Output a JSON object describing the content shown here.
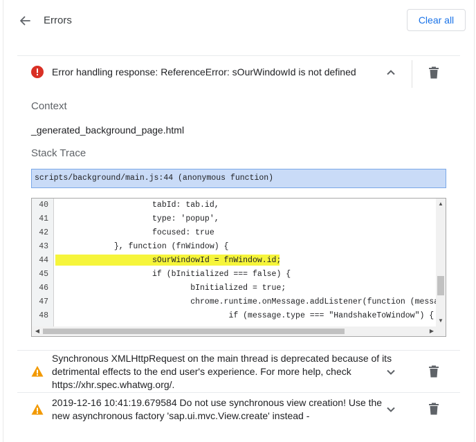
{
  "header": {
    "title": "Errors",
    "clear_label": "Clear all"
  },
  "errors": [
    {
      "level": "error",
      "message": "Error handling response: ReferenceError: sOurWindowId is not defined",
      "expanded": true
    },
    {
      "level": "warning",
      "message_lines": [
        "Synchronous XMLHttpRequest on the main thread is deprecated because of its",
        "detrimental effects to the end user's experience. For more help, check",
        "https://xhr.spec.whatwg.org/."
      ],
      "expanded": false
    },
    {
      "level": "warning",
      "message_lines": [
        "2019-12-16 10:41:19.679584 Do not use synchronous view creation! Use the",
        "new asynchronous factory 'sap.ui.mvc.View.create' instead -"
      ],
      "expanded": false
    }
  ],
  "details": {
    "context_label": "Context",
    "context_value": "_generated_background_page.html",
    "stack_label": "Stack Trace",
    "stack_frame": "scripts/background/main.js:44 (anonymous function)"
  },
  "code": {
    "highlight_line": 44,
    "lines": [
      {
        "n": "40",
        "text": "                    tabId: tab.id,"
      },
      {
        "n": "41",
        "text": "                    type: 'popup',"
      },
      {
        "n": "42",
        "text": "                    focused: true"
      },
      {
        "n": "43",
        "text": "            }, function (fnWindow) {"
      },
      {
        "n": "44",
        "text": "                    sOurWindowId = fnWindow.id;"
      },
      {
        "n": "45",
        "text": "                    if (bInitialized === false) {"
      },
      {
        "n": "46",
        "text": "                            bInitialized = true;"
      },
      {
        "n": "47",
        "text": "                            chrome.runtime.onMessage.addListener(function (message,"
      },
      {
        "n": "48",
        "text": "                                    if (message.type === \"HandshakeToWindow\") {"
      }
    ]
  },
  "colors": {
    "accent": "#1a73e8",
    "error": "#d93025",
    "warning": "#f29900",
    "highlight": "#f6f53b",
    "selected_frame": "#c9dbf7"
  }
}
